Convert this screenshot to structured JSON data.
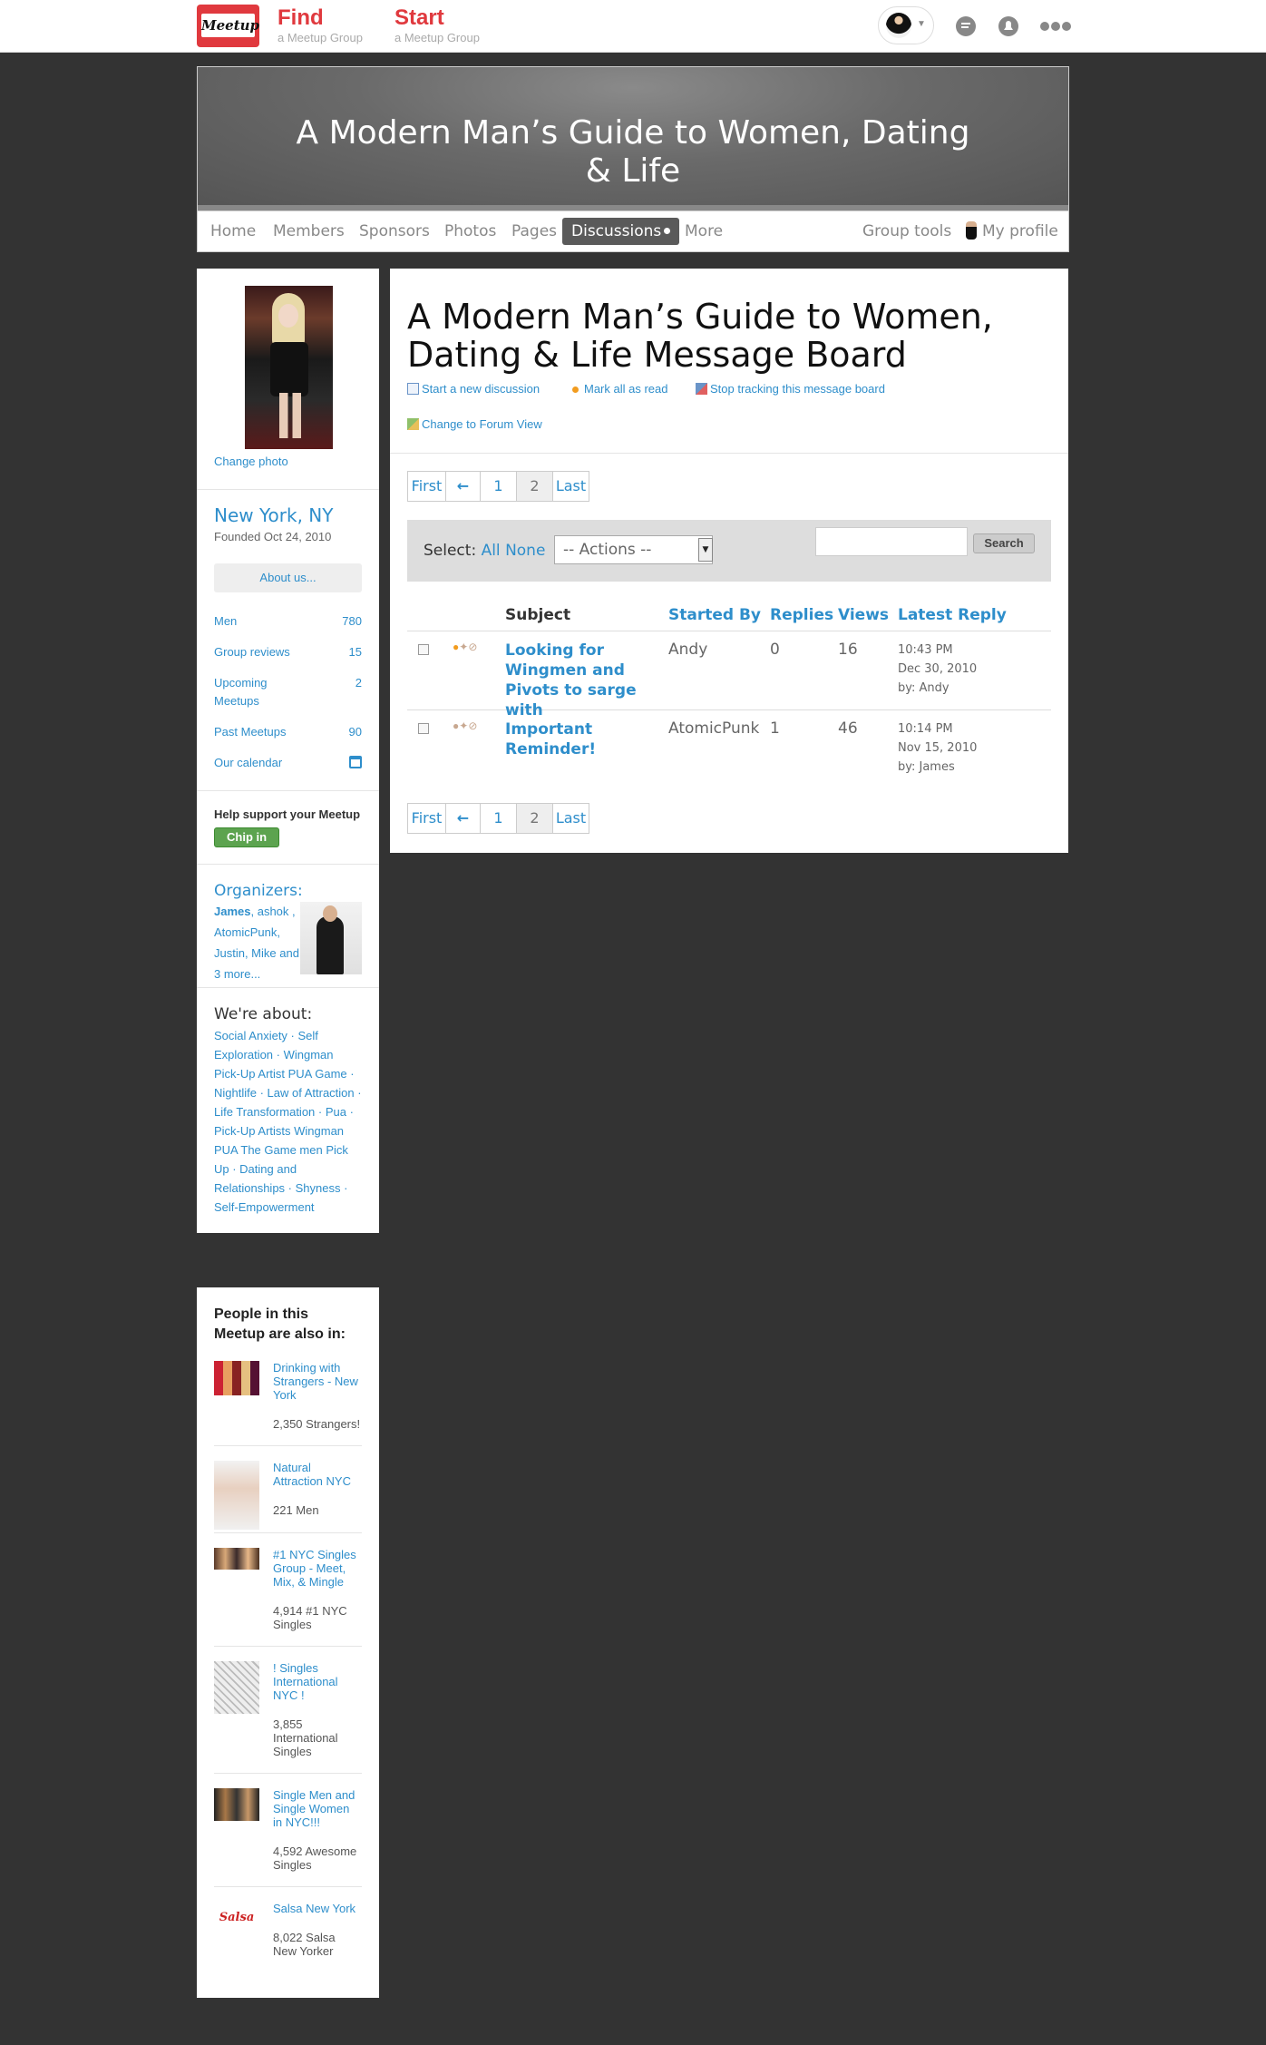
{
  "topbar": {
    "logo_text": "Meetup",
    "find_label": "Find",
    "find_sub": "a Meetup Group",
    "start_label": "Start",
    "start_sub": "a Meetup Group"
  },
  "banner": {
    "title": "A Modern Man’s Guide to Women, Dating & Life"
  },
  "tabs": [
    {
      "label": "Home"
    },
    {
      "label": "Members"
    },
    {
      "label": "Sponsors"
    },
    {
      "label": "Photos"
    },
    {
      "label": "Pages"
    },
    {
      "label": "Discussions"
    },
    {
      "label": "More"
    },
    {
      "label": "Group tools"
    },
    {
      "label": "My profile"
    }
  ],
  "sidebar": {
    "change_photo": "Change photo",
    "city": "New York, NY",
    "founded": "Founded Oct 24, 2010",
    "about_button": "About us...",
    "stats": [
      {
        "label": "Men",
        "value": "780"
      },
      {
        "label": "Group reviews",
        "value": "15"
      },
      {
        "label": "Upcoming Meetups",
        "value": "2"
      },
      {
        "label": "Past Meetups",
        "value": "90"
      },
      {
        "label": "Our calendar",
        "value": ""
      }
    ],
    "help_text": "Help support your Meetup",
    "chip_in": "Chip in",
    "organizers_title": "Organizers:",
    "organizer_lead": "James",
    "organizers_rest": ", ashok , AtomicPunk, Justin, Mike and 3 more...",
    "about_title": "We're about:",
    "topics": "Social Anxiety · Self Exploration · Wingman Pick-Up Artist PUA Game · Nightlife · Law of Attraction · Life Transformation · Pua · Pick-Up Artists Wingman PUA The Game men Pick Up · Dating and Relationships · Shyness · Self-Empowerment"
  },
  "also_in": {
    "title": "People in this Meetup are also in:",
    "groups": [
      {
        "name": "Drinking with Strangers - New York",
        "count": "2,350 Strangers!"
      },
      {
        "name": "Natural Attraction NYC",
        "count": "221 Men"
      },
      {
        "name": "#1 NYC Singles Group - Meet, Mix, & Mingle",
        "count": "4,914 #1 NYC Singles"
      },
      {
        "name": "! Singles International NYC !",
        "count": "3,855 International Singles"
      },
      {
        "name": "Single Men and Single Women in NYC!!!",
        "count": "4,592 Awesome Singles"
      },
      {
        "name": "Salsa New York",
        "count": "8,022 Salsa New Yorker"
      }
    ],
    "thumb_labels": {
      "salsa": "Salsa"
    }
  },
  "board": {
    "title": "A Modern Man’s Guide to Women, Dating & Life Message Board",
    "actions": {
      "new_discussion": "Start a new discussion",
      "mark_read": "Mark all as read",
      "stop_tracking": "Stop tracking this message board",
      "forum_view": "Change to Forum View"
    },
    "pager": {
      "first": "First",
      "prev": "←",
      "p1": "1",
      "p2": "2",
      "last": "Last"
    },
    "select": {
      "label": "Select:",
      "all": "All",
      "none": "None",
      "actions_value": "-- Actions --",
      "search_button": "Search",
      "search_value": ""
    },
    "columns": {
      "subject": "Subject",
      "started_by": "Started By",
      "replies": "Replies",
      "views": "Views",
      "latest": "Latest Reply"
    },
    "rows": [
      {
        "subject": "Looking for Wingmen and Pivots to sarge with",
        "started_by": "Andy",
        "replies": "0",
        "views": "16",
        "latest_time": "10:43 PM",
        "latest_date": "Dec 30, 2010",
        "latest_by": "by: Andy"
      },
      {
        "subject": "Important Reminder!",
        "started_by": "AtomicPunk",
        "replies": "1",
        "views": "46",
        "latest_time": "10:14 PM",
        "latest_date": "Nov 15, 2010",
        "latest_by": "by: James"
      }
    ]
  },
  "colors": {
    "brand_red": "#e0393e",
    "link_blue": "#2e8ecb",
    "page_bg": "#333333",
    "chip_green": "#5ca34f"
  }
}
